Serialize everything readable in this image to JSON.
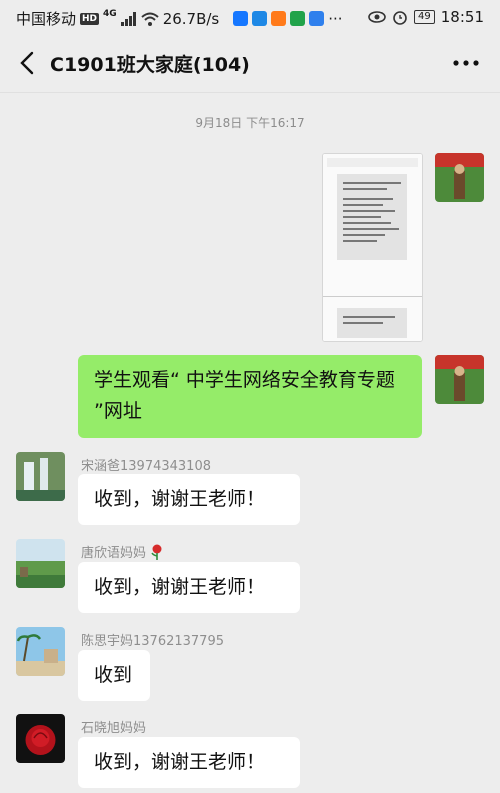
{
  "status_bar": {
    "carrier": "中国移动",
    "hd": "HD",
    "network": "4G",
    "speed": "26.7B/s",
    "battery": "49",
    "time": "18:51"
  },
  "header": {
    "title": "C1901班大家庭(104)"
  },
  "chat": {
    "timestamp": "9月18日 下午16:17",
    "messages": [
      {
        "text": "学生观看“ 中学生网络安全教育专题 ”网址"
      },
      {
        "sender": "宋涵爸13974343108",
        "text": "收到，谢谢王老师！"
      },
      {
        "sender": "唐欣语妈妈",
        "text": "收到，谢谢王老师！"
      },
      {
        "sender": "陈思宇妈13762137795",
        "text": "收到"
      },
      {
        "sender": "石晓旭妈妈",
        "text": "收到，谢谢王老师！"
      }
    ]
  }
}
